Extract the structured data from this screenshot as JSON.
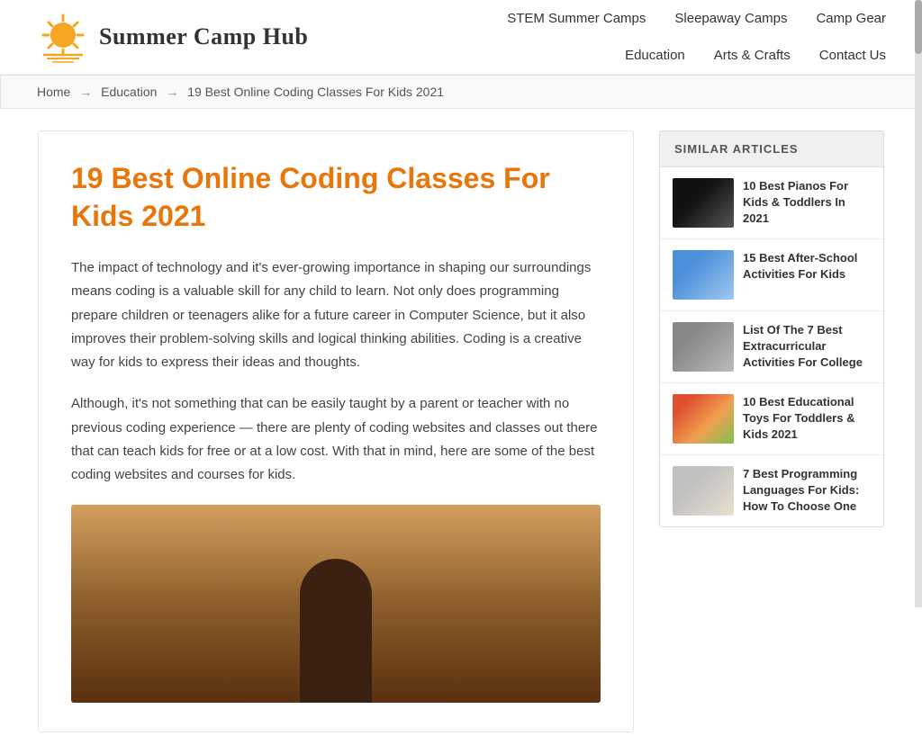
{
  "site": {
    "name": "Summer Camp Hub",
    "logo_alt": "Summer Camp Hub Logo"
  },
  "nav": {
    "row1": [
      {
        "id": "stem",
        "label": "STEM Summer Camps"
      },
      {
        "id": "sleepaway",
        "label": "Sleepaway Camps"
      },
      {
        "id": "gear",
        "label": "Camp Gear"
      }
    ],
    "row2": [
      {
        "id": "education",
        "label": "Education"
      },
      {
        "id": "arts",
        "label": "Arts & Crafts"
      },
      {
        "id": "contact",
        "label": "Contact Us"
      }
    ]
  },
  "breadcrumb": {
    "home": "Home",
    "education": "Education",
    "current": "19 Best Online Coding Classes For Kids 2021",
    "arrow": "→"
  },
  "article": {
    "title": "19 Best Online Coding Classes For Kids 2021",
    "paragraphs": [
      "The impact of technology and it's ever-growing importance in shaping our surroundings means coding is a valuable skill for any child to learn. Not only does programming prepare children or teenagers alike for a future career in Computer Science, but it also improves their problem-solving skills and logical thinking abilities. Coding is a creative way for kids to express their ideas and thoughts.",
      "Although, it's not something that can be easily taught by a parent or teacher with no previous coding experience — there are plenty of coding websites and classes out there that can teach kids for free or at a low cost. With that in mind, here are some of the best coding websites and courses for kids."
    ]
  },
  "sidebar": {
    "header": "SIMILAR ARTICLES",
    "items": [
      {
        "id": "pianos",
        "thumb_type": "piano",
        "title": "10 Best Pianos For Kids & Toddlers In 2021"
      },
      {
        "id": "afterschool",
        "thumb_type": "crafts",
        "title": "15 Best After-School Activities For Kids"
      },
      {
        "id": "extracurricular",
        "thumb_type": "activities",
        "title": "List Of The 7 Best Extracurricular Activities For College"
      },
      {
        "id": "toys",
        "thumb_type": "toys",
        "title": "10 Best Educational Toys For Toddlers & Kids 2021"
      },
      {
        "id": "programming",
        "thumb_type": "programming",
        "title": "7 Best Programming Languages For Kids: How To Choose One"
      }
    ]
  }
}
